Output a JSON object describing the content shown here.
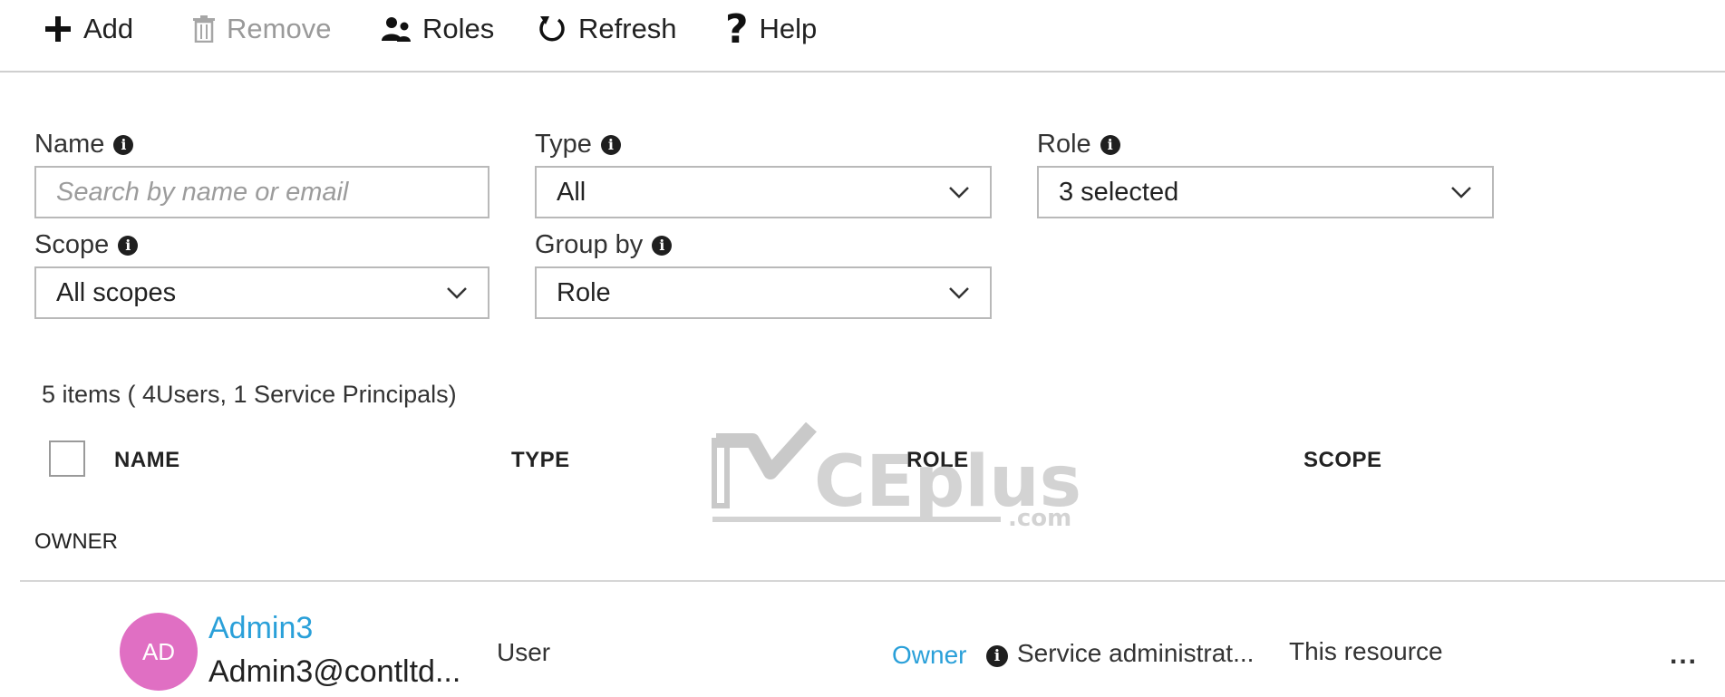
{
  "toolbar": {
    "add_label": "Add",
    "remove_label": "Remove",
    "roles_label": "Roles",
    "refresh_label": "Refresh",
    "help_label": "Help"
  },
  "filters": {
    "name_label": "Name",
    "name_placeholder": "Search by name or email",
    "type_label": "Type",
    "type_value": "All",
    "role_label": "Role",
    "role_value": "3 selected",
    "scope_label": "Scope",
    "scope_value": "All scopes",
    "groupby_label": "Group by",
    "groupby_value": "Role"
  },
  "summary": "5 items ( 4Users, 1 Service Principals)",
  "table": {
    "columns": [
      "NAME",
      "TYPE",
      "ROLE",
      "SCOPE"
    ],
    "group": "OWNER",
    "rows": [
      {
        "initials": "AD",
        "name": "Admin3",
        "email": "Admin3@contltd...",
        "type": "User",
        "role": "Owner",
        "role_desc": "Service administrat...",
        "scope": "This resource",
        "more": "..."
      }
    ]
  },
  "watermark": {
    "main": "CEplus",
    "suffix": ".com"
  },
  "colors": {
    "link": "#2aa0d9",
    "avatar": "#e06fc3",
    "border": "#b9b9b9",
    "disabled": "#9a9a9a"
  }
}
